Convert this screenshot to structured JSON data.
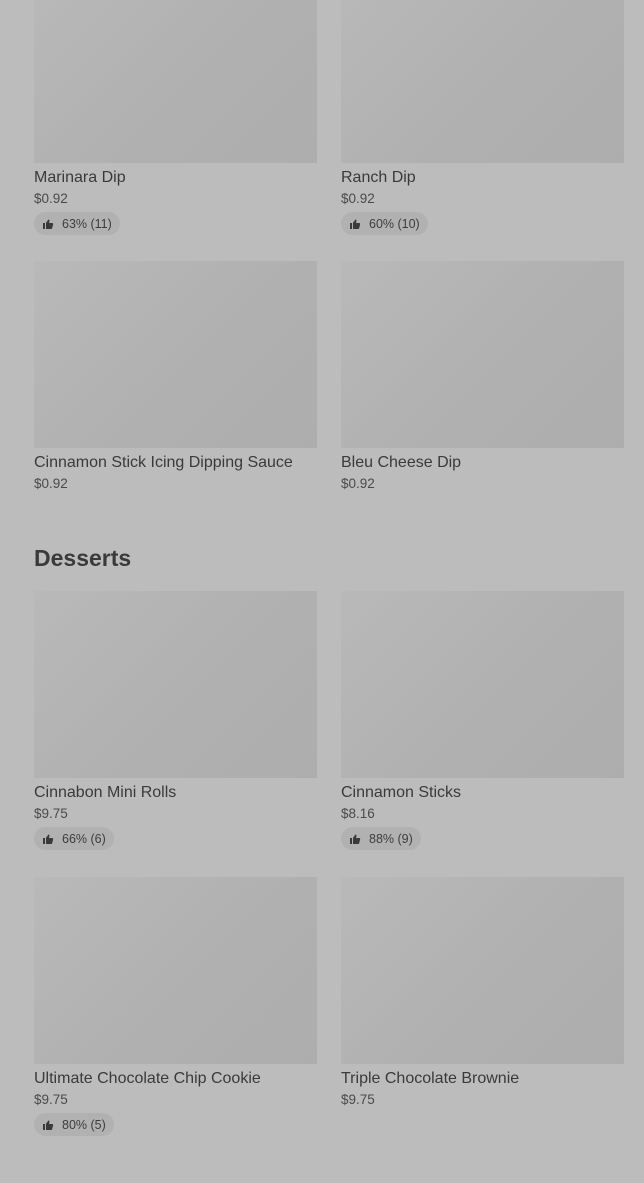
{
  "sections": [
    {
      "title": "",
      "items": [
        {
          "name": "Marinara Dip",
          "price": "$0.92",
          "rating": "63% (11)"
        },
        {
          "name": "Ranch Dip",
          "price": "$0.92",
          "rating": "60% (10)"
        },
        {
          "name": "Cinnamon Stick Icing Dipping Sauce",
          "price": "$0.92",
          "rating": ""
        },
        {
          "name": "Bleu Cheese Dip",
          "price": "$0.92",
          "rating": ""
        }
      ]
    },
    {
      "title": "Desserts",
      "items": [
        {
          "name": "Cinnabon Mini Rolls",
          "price": "$9.75",
          "rating": "66% (6)"
        },
        {
          "name": "Cinnamon Sticks",
          "price": "$8.16",
          "rating": "88% (9)"
        },
        {
          "name": "Ultimate Chocolate Chip Cookie",
          "price": "$9.75",
          "rating": "80% (5)"
        },
        {
          "name": "Triple Chocolate Brownie",
          "price": "$9.75",
          "rating": ""
        }
      ]
    }
  ],
  "icons": {
    "rating": "thumbs-up-icon"
  },
  "colors": {
    "background": "#bcbcbc",
    "image_placeholder": "#b3b3b3",
    "rating_pill": "#b1b1b1",
    "text": "#3a3a3a"
  }
}
